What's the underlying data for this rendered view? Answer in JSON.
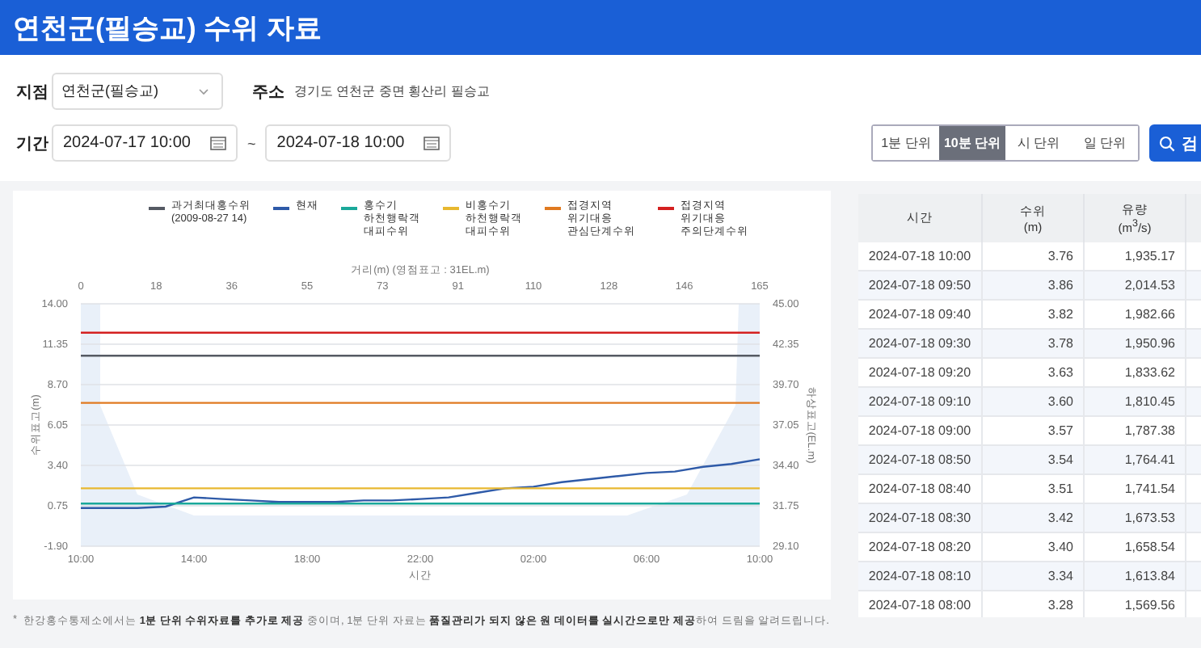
{
  "header": {
    "title": "연천군(필승교) 수위 자료"
  },
  "filters": {
    "station": {
      "label": "지점",
      "value": "연천군(필승교)"
    },
    "address": {
      "label": "주소",
      "value": "경기도 연천군 중면 횡산리 필승교"
    },
    "period": {
      "label": "기간",
      "from": "2024-07-17 10:00",
      "separator": "~",
      "to": "2024-07-18 10:00"
    }
  },
  "units": [
    {
      "label": "1분 단위",
      "selected": false
    },
    {
      "label": "10분 단위",
      "selected": true
    },
    {
      "label": "시 단위",
      "selected": false
    },
    {
      "label": "일 단위",
      "selected": false
    }
  ],
  "search_button": {
    "label": "검"
  },
  "chart": {
    "top_axis": {
      "title": "거리(m) (영점표고 : 31EL.m)",
      "ticks": [
        "0",
        "18",
        "36",
        "55",
        "73",
        "91",
        "110",
        "128",
        "146",
        "165"
      ]
    },
    "right_axis": {
      "title": "하상표고(EL.m)",
      "ticks": [
        "45.00",
        "42.35",
        "39.70",
        "37.05",
        "34.40",
        "31.75",
        "29.10"
      ]
    },
    "chart_data": {
      "type": "line",
      "xlabel": "시간",
      "ylabel": "수위표고(m)",
      "categories": [
        "10:00",
        null,
        null,
        null,
        "14:00",
        null,
        null,
        null,
        "18:00",
        null,
        null,
        null,
        "22:00",
        null,
        null,
        null,
        "02:00",
        null,
        null,
        null,
        "06:00",
        null,
        null,
        null,
        "10:00"
      ],
      "ylim": [
        -1.9,
        14
      ],
      "grid": true,
      "yticks": [
        {
          "value": 14,
          "label": "14.00"
        },
        {
          "value": 11.35,
          "label": "11.35"
        },
        {
          "value": 8.7,
          "label": "8.70"
        },
        {
          "value": 6.05,
          "label": "6.05"
        },
        {
          "value": 3.4,
          "label": "3.40"
        },
        {
          "value": 0.75,
          "label": "0.75"
        },
        {
          "value": -1.9,
          "label": "-1.90"
        }
      ],
      "series": [
        {
          "name": "과거최대홍수위\n(2009-08-27 14)",
          "color": "#555a63",
          "values": [
            10.6,
            10.6,
            10.6,
            10.6,
            10.6,
            10.6,
            10.6,
            10.6,
            10.6,
            10.6,
            10.6,
            10.6,
            10.6,
            10.6,
            10.6,
            10.6,
            10.6,
            10.6,
            10.6,
            10.6,
            10.6,
            10.6,
            10.6,
            10.6,
            10.6
          ]
        },
        {
          "name": "현재",
          "color": "#2e5aa8",
          "values": [
            0.6,
            0.6,
            0.6,
            0.7,
            1.3,
            1.2,
            1.1,
            1.0,
            1.0,
            1.0,
            1.1,
            1.1,
            1.2,
            1.3,
            1.6,
            1.9,
            2.0,
            2.3,
            2.5,
            2.7,
            2.9,
            3.0,
            3.3,
            3.5,
            3.8
          ]
        },
        {
          "name": "홍수기\n하천행락객\n대피수위",
          "color": "#1aa89a",
          "values": [
            0.9,
            0.9,
            0.9,
            0.9,
            0.9,
            0.9,
            0.9,
            0.9,
            0.9,
            0.9,
            0.9,
            0.9,
            0.9,
            0.9,
            0.9,
            0.9,
            0.9,
            0.9,
            0.9,
            0.9,
            0.9,
            0.9,
            0.9,
            0.9,
            0.9
          ]
        },
        {
          "name": "비홍수기\n하천행락객\n대피수위",
          "color": "#e8b830",
          "values": [
            1.9,
            1.9,
            1.9,
            1.9,
            1.9,
            1.9,
            1.9,
            1.9,
            1.9,
            1.9,
            1.9,
            1.9,
            1.9,
            1.9,
            1.9,
            1.9,
            1.9,
            1.9,
            1.9,
            1.9,
            1.9,
            1.9,
            1.9,
            1.9,
            1.9
          ]
        },
        {
          "name": "접경지역\n위기대응\n관심단계수위",
          "color": "#e07a20",
          "values": [
            7.5,
            7.5,
            7.5,
            7.5,
            7.5,
            7.5,
            7.5,
            7.5,
            7.5,
            7.5,
            7.5,
            7.5,
            7.5,
            7.5,
            7.5,
            7.5,
            7.5,
            7.5,
            7.5,
            7.5,
            7.5,
            7.5,
            7.5,
            7.5,
            7.5
          ]
        },
        {
          "name": "접경지역\n위기대응\n주의단계수위",
          "color": "#d42020",
          "values": [
            12.1,
            12.1,
            12.1,
            12.1,
            12.1,
            12.1,
            12.1,
            12.1,
            12.1,
            12.1,
            12.1,
            12.1,
            12.1,
            12.1,
            12.1,
            12.1,
            12.1,
            12.1,
            12.1,
            12.1,
            12.1,
            12.1,
            12.1,
            12.1,
            12.1
          ]
        }
      ]
    }
  },
  "table": {
    "columns": [
      "시간",
      "수위\n(m)",
      "유량\n(m$^{3}$/s)"
    ],
    "rows": [
      [
        "2024-07-18 10:00",
        "3.76",
        "1,935.17"
      ],
      [
        "2024-07-18 09:50",
        "3.86",
        "2,014.53"
      ],
      [
        "2024-07-18 09:40",
        "3.82",
        "1,982.66"
      ],
      [
        "2024-07-18 09:30",
        "3.78",
        "1,950.96"
      ],
      [
        "2024-07-18 09:20",
        "3.63",
        "1,833.62"
      ],
      [
        "2024-07-18 09:10",
        "3.60",
        "1,810.45"
      ],
      [
        "2024-07-18 09:00",
        "3.57",
        "1,787.38"
      ],
      [
        "2024-07-18 08:50",
        "3.54",
        "1,764.41"
      ],
      [
        "2024-07-18 08:40",
        "3.51",
        "1,741.54"
      ],
      [
        "2024-07-18 08:30",
        "3.42",
        "1,673.53"
      ],
      [
        "2024-07-18 08:20",
        "3.40",
        "1,658.54"
      ],
      [
        "2024-07-18 08:10",
        "3.34",
        "1,613.84"
      ],
      [
        "2024-07-18 08:00",
        "3.28",
        "1,569.56"
      ]
    ]
  },
  "footnote": {
    "mark": "*",
    "text": "한강홍수통제소에서는 **1분 단위 수위자료를 추가로 제공** 중이며, 1분 단위 자료는 **품질관리가 되지 않은 원 데이터를 실시간으로만 제공**하여 드림을 알려드립니다."
  }
}
